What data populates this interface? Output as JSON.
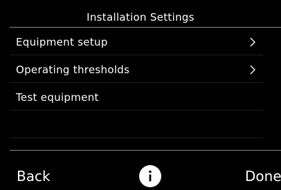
{
  "header": {
    "title": "Installation Settings"
  },
  "menu": {
    "items": [
      {
        "label": "Equipment setup",
        "icon": "chevron-right-icon"
      },
      {
        "label": "Operating thresholds",
        "icon": "chevron-right-icon"
      },
      {
        "label": "Test equipment"
      }
    ]
  },
  "footer": {
    "back_label": "Back",
    "info_icon": "info-icon",
    "done_label": "Done"
  },
  "colors": {
    "background": "#000000",
    "text": "#ffffff",
    "divider": "#8a8a8a"
  }
}
